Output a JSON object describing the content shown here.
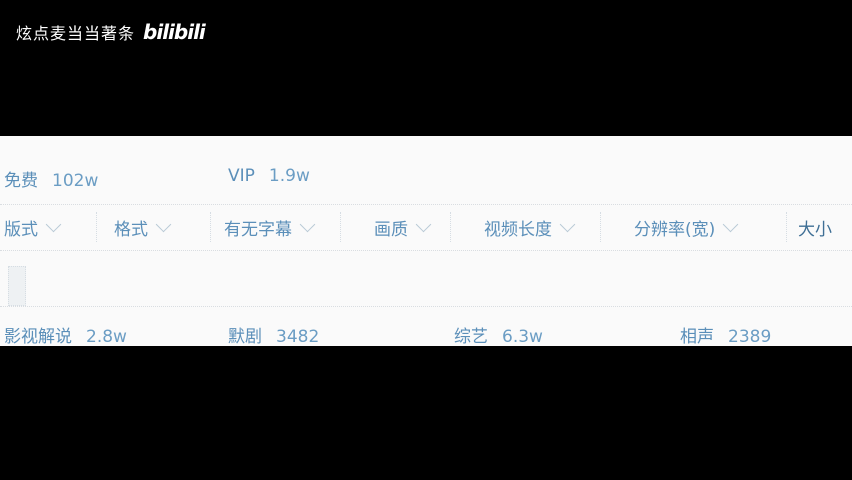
{
  "watermark": {
    "text": "炫点麦当当著条",
    "logo": "bilibili"
  },
  "top_stats": [
    {
      "label": "免费",
      "value": "102w"
    },
    {
      "label": "VIP",
      "value": "1.9w"
    }
  ],
  "filters": [
    {
      "label": "版式"
    },
    {
      "label": "格式"
    },
    {
      "label": "有无字幕"
    },
    {
      "label": "画质"
    },
    {
      "label": "视频长度"
    },
    {
      "label": "分辨率(宽)"
    },
    {
      "label": "大小"
    }
  ],
  "bottom_stats": [
    {
      "label": "影视解说",
      "value": "2.8w"
    },
    {
      "label": "默剧",
      "value": "3482"
    },
    {
      "label": "综艺",
      "value": "6.3w"
    },
    {
      "label": "相声",
      "value": "2389"
    }
  ]
}
